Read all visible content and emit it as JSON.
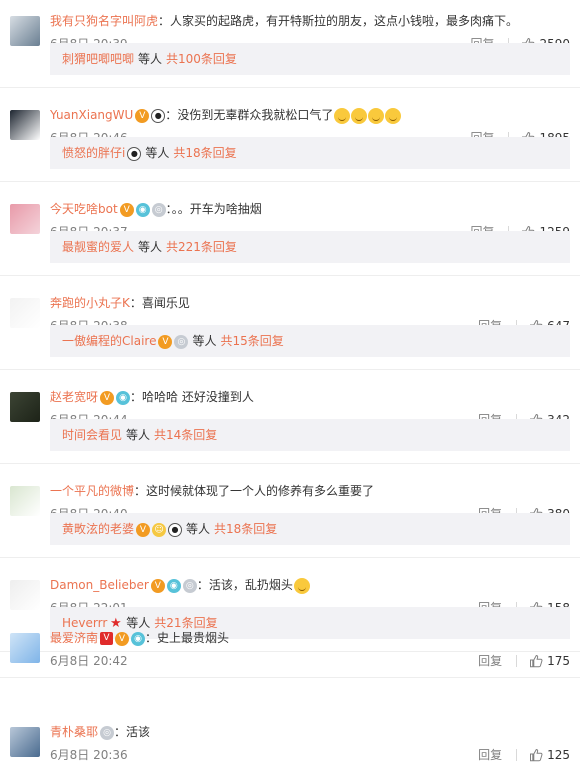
{
  "reply_label": "回复",
  "etc_label": "等人",
  "comments": [
    {
      "user": "我有只狗名字叫阿虎",
      "badges": [],
      "text": "人家买的起路虎，有开特斯拉的朋友，这点小钱啦，最多肉痛下。",
      "time": "6月8日 20:39",
      "likes": "2590",
      "sub": {
        "user": "刺猬吧唧吧唧",
        "badges": [],
        "total": "共100条回复"
      }
    },
    {
      "user": "YuanXiangWU",
      "badges": [
        "vip",
        "panda"
      ],
      "text": "没伤到无辜群众我就松口气了",
      "emojis": 4,
      "time": "6月8日 20:46",
      "likes": "1895",
      "sub": {
        "user": "愤怒的胖仔i",
        "badges": [
          "panda"
        ],
        "total": "共18条回复"
      }
    },
    {
      "user": "今天吃啥bot",
      "badges": [
        "vip",
        "lv",
        "ring"
      ],
      "text": "。。开车为啥抽烟",
      "time": "6月8日 20:37",
      "likes": "1259",
      "sub": {
        "user": "最靓蜜的爱人",
        "badges": [],
        "total": "共221条回复"
      }
    },
    {
      "user": "奔跑的小丸子K",
      "badges": [],
      "text": "喜闻乐见",
      "time": "6月8日 20:38",
      "likes": "647",
      "sub": {
        "user": "一傲编程的Claire",
        "badges": [
          "vip",
          "ring"
        ],
        "total": "共15条回复"
      }
    },
    {
      "user": "赵老宽呀",
      "badges": [
        "vip",
        "lv"
      ],
      "text": "哈哈哈 还好没撞到人",
      "time": "6月8日 20:44",
      "likes": "342",
      "sub": {
        "user": "时间会看见",
        "badges": [],
        "total": "共14条回复"
      }
    },
    {
      "user": "一个平凡的微博",
      "badges": [],
      "text": "这时候就体现了一个人的修养有多么重要了",
      "time": "6月8日 20:40",
      "likes": "380",
      "sub": {
        "user": "黄畋泫的老婆",
        "badges": [
          "vip",
          "emo",
          "panda"
        ],
        "total": "共18条回复"
      }
    },
    {
      "user": "Damon_Belieber",
      "badges": [
        "vip",
        "lv",
        "ring"
      ],
      "text": "活该，乱扔烟头",
      "emojis": 1,
      "time": "6月8日 22:01",
      "likes": "158",
      "sub": {
        "user": "Heverrr",
        "badges": [
          "star"
        ],
        "total": "共21条回复"
      }
    },
    {
      "user": "最爱济南",
      "badges": [
        "red",
        "vip",
        "lv"
      ],
      "text": "史上最贵烟头",
      "time": "6月8日 20:42",
      "likes": "175",
      "sub": null
    },
    {
      "user": "青朴桑耶",
      "badges": [
        "ring"
      ],
      "text": "活该",
      "time": "6月8日 20:36",
      "likes": "125",
      "sub": null
    }
  ]
}
